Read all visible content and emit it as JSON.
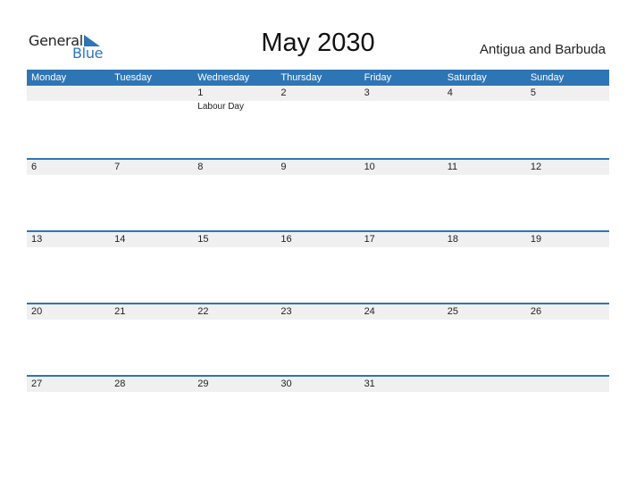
{
  "logo": {
    "line1": "General",
    "line2": "Blue"
  },
  "title": "May 2030",
  "country": "Antigua and Barbuda",
  "colors": {
    "accent": "#2e75b6",
    "row_bg": "#f0f0f0"
  },
  "weekdays": [
    "Monday",
    "Tuesday",
    "Wednesday",
    "Thursday",
    "Friday",
    "Saturday",
    "Sunday"
  ],
  "weeks": [
    {
      "days": [
        "",
        "",
        "1",
        "2",
        "3",
        "4",
        "5"
      ],
      "events": [
        "",
        "",
        "Labour Day",
        "",
        "",
        "",
        ""
      ]
    },
    {
      "days": [
        "6",
        "7",
        "8",
        "9",
        "10",
        "11",
        "12"
      ],
      "events": [
        "",
        "",
        "",
        "",
        "",
        "",
        ""
      ]
    },
    {
      "days": [
        "13",
        "14",
        "15",
        "16",
        "17",
        "18",
        "19"
      ],
      "events": [
        "",
        "",
        "",
        "",
        "",
        "",
        ""
      ]
    },
    {
      "days": [
        "20",
        "21",
        "22",
        "23",
        "24",
        "25",
        "26"
      ],
      "events": [
        "",
        "",
        "",
        "",
        "",
        "",
        ""
      ]
    },
    {
      "days": [
        "27",
        "28",
        "29",
        "30",
        "31",
        "",
        ""
      ],
      "events": [
        "",
        "",
        "",
        "",
        "",
        "",
        ""
      ]
    }
  ]
}
